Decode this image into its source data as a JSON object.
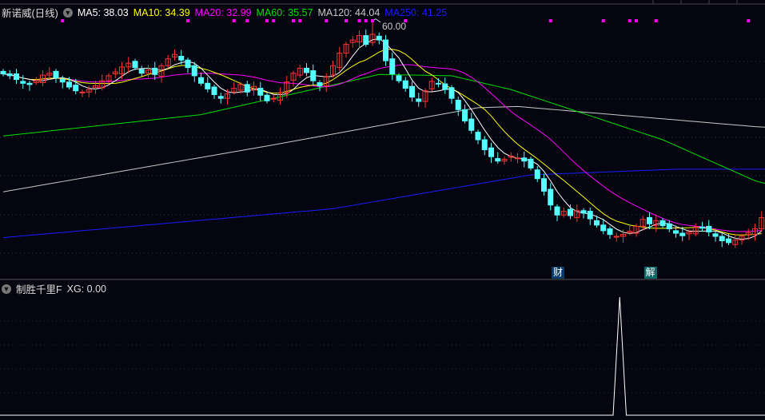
{
  "header": {
    "stock": "新诺威(日线)",
    "ma": [
      {
        "label": "MA5: 38.03",
        "color": "#ffffff"
      },
      {
        "label": "MA10: 34.39",
        "color": "#ffff00"
      },
      {
        "label": "MA20: 32.99",
        "color": "#ff00ff"
      },
      {
        "label": "MA60: 35.57",
        "color": "#00e000"
      },
      {
        "label": "MA120: 44.04",
        "color": "#c8c8c8"
      },
      {
        "label": "MA250: 41.25",
        "color": "#1a1aff"
      }
    ]
  },
  "indicator": {
    "title": "制胜千里F",
    "value_label": "XG: 0.00"
  },
  "markers": {
    "cai": "财",
    "jie": "解",
    "high_label": "60.00"
  },
  "chart_data": {
    "type": "candlestick",
    "ylim": [
      20,
      62
    ],
    "closes": [
      51.5,
      51.2,
      50.6,
      50.0,
      49.8,
      50.4,
      51.3,
      51.6,
      50.9,
      50.2,
      49.4,
      48.8,
      48.6,
      49.0,
      49.6,
      50.4,
      51.2,
      51.8,
      52.6,
      53.2,
      52.5,
      51.6,
      52.1,
      51.4,
      52.8,
      53.9,
      54.6,
      53.7,
      52.5,
      51.2,
      50.0,
      49.1,
      48.2,
      47.6,
      48.3,
      49.2,
      49.8,
      48.6,
      49.5,
      48.1,
      47.2,
      47.6,
      48.5,
      50.2,
      51.6,
      52.4,
      51.7,
      50.4,
      49.6,
      51.0,
      52.8,
      54.8,
      56.2,
      56.9,
      57.6,
      56.2,
      57.8,
      56.9,
      53.6,
      51.5,
      50.4,
      49.2,
      47.8,
      47.1,
      48.8,
      50.3,
      49.9,
      49.0,
      47.6,
      45.8,
      44.0,
      42.5,
      41.0,
      39.4,
      38.3,
      37.6,
      37.9,
      38.4,
      38.1,
      37.6,
      36.5,
      34.8,
      32.8,
      30.6,
      29.0,
      29.6,
      28.9,
      29.7,
      29.3,
      28.4,
      27.4,
      26.5,
      25.9,
      25.6,
      25.9,
      26.4,
      27.2,
      28.3,
      27.6,
      28.1,
      27.3,
      26.8,
      26.1,
      25.7,
      26.3,
      27.1,
      26.9,
      26.3,
      25.6,
      24.9,
      24.6,
      25.0,
      25.6,
      26.2,
      26.8,
      28.6
    ],
    "high_point": {
      "index": 56,
      "value": 60.0
    },
    "ma60": [
      [
        0,
        41.6
      ],
      [
        30,
        45
      ],
      [
        57,
        51.4
      ],
      [
        68,
        51.2
      ],
      [
        77,
        49.0
      ],
      [
        100,
        41
      ],
      [
        115,
        34
      ]
    ],
    "ma120": [
      [
        0,
        32.7
      ],
      [
        40,
        40
      ],
      [
        72,
        46.1
      ],
      [
        78,
        46.3
      ],
      [
        115,
        43
      ]
    ],
    "ma250": [
      [
        0,
        25.4
      ],
      [
        50,
        30
      ],
      [
        80,
        35.4
      ],
      [
        102,
        36.3
      ],
      [
        115,
        36.3
      ]
    ],
    "signal_dots": [
      9,
      28,
      35,
      37,
      40,
      41,
      44,
      45,
      49,
      52,
      54,
      55,
      56,
      61,
      83,
      91,
      95,
      96,
      99,
      113
    ],
    "event_markers": {
      "cai": 84,
      "jie": 98
    },
    "xg_signals": [
      93
    ],
    "xg_ylim": [
      0,
      1
    ],
    "colors": {
      "up": "#ff3232",
      "down": "#54ffff",
      "ma5": "#ffffff",
      "ma10": "#ffff00",
      "ma20": "#ff00ff",
      "ma60": "#00e000",
      "ma120": "#c8c8c8",
      "ma250": "#1a1aff",
      "dot": "#ff00ff"
    }
  }
}
